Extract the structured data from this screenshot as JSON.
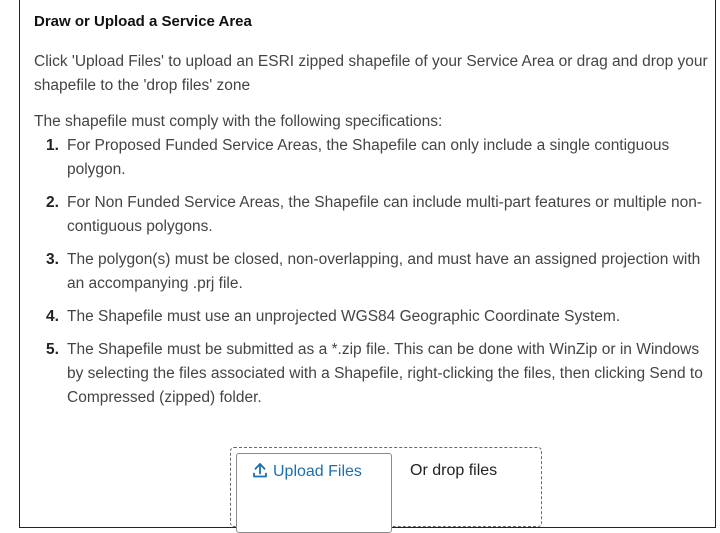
{
  "panel": {
    "title": "Draw or Upload a Service Area",
    "intro": "Click 'Upload Files' to upload an ESRI zipped shapefile of your Service Area or drag and drop your shapefile to the 'drop files' zone",
    "spec_intro": "The shapefile must comply with the following specifications:",
    "specs": [
      {
        "num": "1.",
        "text": "For Proposed Funded Service Areas, the Shapefile can only include a single contiguous polygon."
      },
      {
        "num": "2.",
        "text": "For Non Funded Service Areas, the Shapefile can include multi-part features or multiple non-contiguous polygons."
      },
      {
        "num": "3.",
        "text": "The polygon(s) must be closed, non-overlapping, and must have an assigned projection with an accompanying .prj file."
      },
      {
        "num": "4.",
        "text": "The Shapefile must use an unprojected WGS84 Geographic Coordinate System."
      },
      {
        "num": "5.",
        "text": "The Shapefile must be submitted as a *.zip file. This can be done with WinZip or in Windows by selecting the files associated with a Shapefile, right-clicking the files, then clicking Send to Compressed (zipped) folder."
      }
    ]
  },
  "upload": {
    "button_label": "Upload Files",
    "button_icon": "upload-icon",
    "drop_label": "Or drop files"
  },
  "colors": {
    "accent": "#1b6fb5",
    "border": "#222222",
    "text": "#444444"
  }
}
